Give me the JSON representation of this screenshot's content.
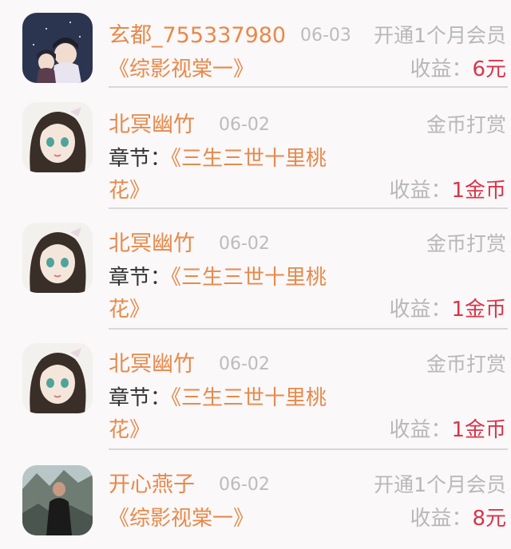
{
  "income_list": {
    "earn_label": "收益：",
    "chapter_label": "章节：",
    "items": [
      {
        "name": "玄都_755337980",
        "date": "06-03",
        "type": "开通1个月会员",
        "book": "《综影视棠一》",
        "earn": "6元"
      },
      {
        "name": "北冥幽竹",
        "date": "06-02",
        "type": "金币打赏",
        "chapter_title": "《三生三世十里桃",
        "chapter_cont": "花》",
        "earn": "1金币"
      },
      {
        "name": "北冥幽竹",
        "date": "06-02",
        "type": "金币打赏",
        "chapter_title": "《三生三世十里桃",
        "chapter_cont": "花》",
        "earn": "1金币"
      },
      {
        "name": "北冥幽竹",
        "date": "06-02",
        "type": "金币打赏",
        "chapter_title": "《三生三世十里桃",
        "chapter_cont": "花》",
        "earn": "1金币"
      },
      {
        "name": "开心燕子",
        "date": "06-02",
        "type": "开通1个月会员",
        "book": "《综影视棠一》",
        "earn": "8元"
      }
    ]
  }
}
